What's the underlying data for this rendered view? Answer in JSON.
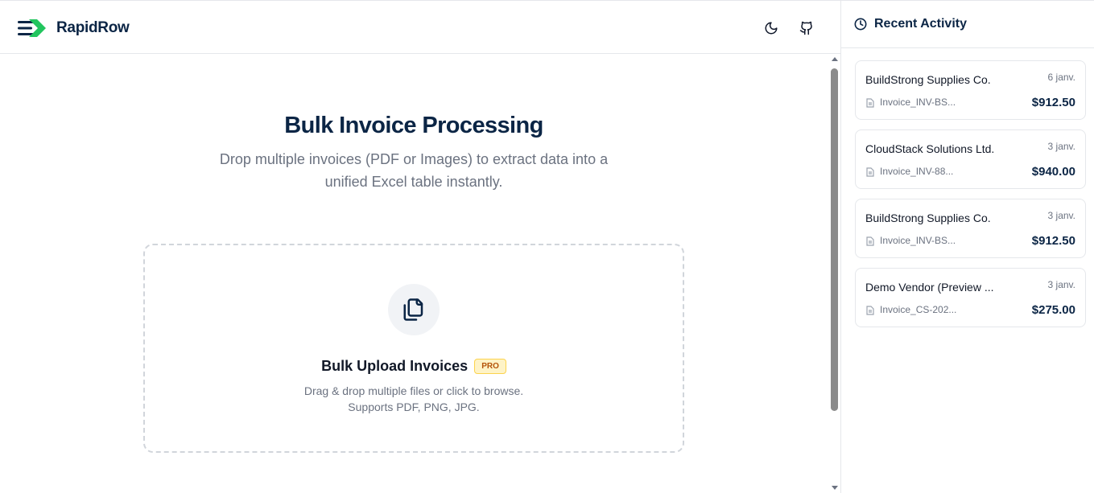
{
  "app": {
    "brand": "RapidRow",
    "logo_icon": "rapidrow-logo-icon",
    "theme_icon": "moon-icon",
    "repo_icon": "github-icon",
    "accent_color": "#22c55e",
    "brand_color": "#0b2545"
  },
  "hero": {
    "title": "Bulk Invoice Processing",
    "subtitle": "Drop multiple invoices (PDF or Images) to extract data into a unified Excel table instantly."
  },
  "upload": {
    "icon": "files-icon",
    "title": "Bulk Upload Invoices",
    "badge": "PRO",
    "hint_line1": "Drag & drop multiple files or click to browse.",
    "hint_line2": "Supports PDF, PNG, JPG."
  },
  "sidebar": {
    "title": "Recent Activity",
    "icon": "clock-icon",
    "items": [
      {
        "vendor": "BuildStrong Supplies Co.",
        "date": "6 janv.",
        "file": "Invoice_INV-BS...",
        "amount": "$912.50"
      },
      {
        "vendor": "CloudStack Solutions Ltd.",
        "date": "3 janv.",
        "file": "Invoice_INV-88...",
        "amount": "$940.00"
      },
      {
        "vendor": "BuildStrong Supplies Co.",
        "date": "3 janv.",
        "file": "Invoice_INV-BS...",
        "amount": "$912.50"
      },
      {
        "vendor": "Demo Vendor (Preview ...",
        "date": "3 janv.",
        "file": "Invoice_CS-202...",
        "amount": "$275.00"
      }
    ]
  }
}
